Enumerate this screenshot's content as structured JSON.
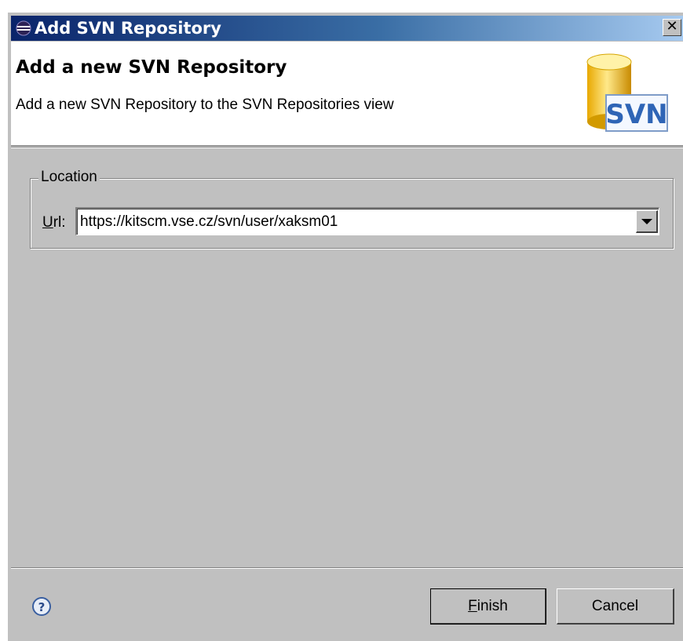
{
  "window": {
    "title": "Add SVN Repository",
    "close_glyph": "✕"
  },
  "banner": {
    "title": "Add a new SVN Repository",
    "description": "Add a new SVN Repository to the SVN Repositories view",
    "logo_text": "SVN"
  },
  "location": {
    "group_label": "Location",
    "url_label_mnemonic": "U",
    "url_label_rest": "rl:",
    "url_value": "https://kitscm.vse.cz/svn/user/xaksm01"
  },
  "footer": {
    "finish_mnemonic": "F",
    "finish_rest": "inish",
    "cancel_label": "Cancel"
  },
  "icons": {
    "title": "eclipse-icon",
    "logo": "svn-repository-icon",
    "help": "help-icon",
    "dropdown": "chevron-down-icon"
  },
  "colors": {
    "titlebar_start": "#0a246a",
    "titlebar_end": "#a6caf0",
    "dialog_bg": "#c0c0c0",
    "banner_bg": "#ffffff"
  }
}
